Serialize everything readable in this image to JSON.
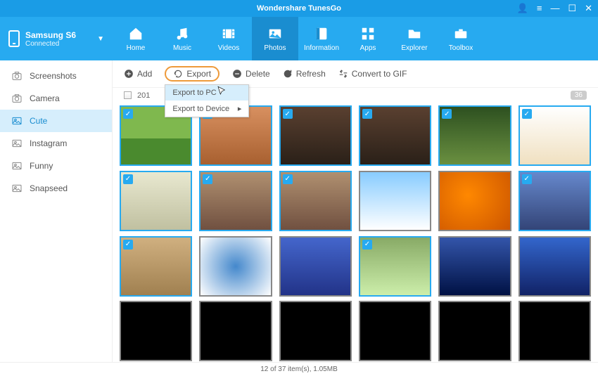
{
  "app": {
    "title": "Wondershare TunesGo"
  },
  "device": {
    "name": "Samsung S6",
    "status": "Connected"
  },
  "nav": [
    {
      "id": "home",
      "label": "Home"
    },
    {
      "id": "music",
      "label": "Music"
    },
    {
      "id": "videos",
      "label": "Videos"
    },
    {
      "id": "photos",
      "label": "Photos",
      "active": true
    },
    {
      "id": "information",
      "label": "Information"
    },
    {
      "id": "apps",
      "label": "Apps"
    },
    {
      "id": "explorer",
      "label": "Explorer"
    },
    {
      "id": "toolbox",
      "label": "Toolbox"
    }
  ],
  "sidebar": [
    {
      "label": "Screenshots",
      "icon": "camera"
    },
    {
      "label": "Camera",
      "icon": "camera"
    },
    {
      "label": "Cute",
      "icon": "picture",
      "active": true
    },
    {
      "label": "Instagram",
      "icon": "picture"
    },
    {
      "label": "Funny",
      "icon": "picture"
    },
    {
      "label": "Snapseed",
      "icon": "picture"
    }
  ],
  "toolbar": {
    "add": "Add",
    "export": "Export",
    "delete": "Delete",
    "refresh": "Refresh",
    "gif": "Convert to GIF"
  },
  "export_menu": {
    "pc": "Export to PC",
    "device": "Export to Device"
  },
  "group": {
    "date": "201",
    "count": "36"
  },
  "thumbs": [
    {
      "cls": "sc-grass",
      "sel": true
    },
    {
      "cls": "sc-basket",
      "sel": true
    },
    {
      "cls": "sc-bridge",
      "sel": true
    },
    {
      "cls": "sc-bridge",
      "sel": true
    },
    {
      "cls": "sc-garden",
      "sel": true
    },
    {
      "cls": "sc-kitten",
      "sel": true
    },
    {
      "cls": "sc-chair",
      "sel": true
    },
    {
      "cls": "sc-blur",
      "sel": true
    },
    {
      "cls": "sc-blur",
      "sel": true
    },
    {
      "cls": "sc-sky",
      "sel": false
    },
    {
      "cls": "sc-orange",
      "sel": false
    },
    {
      "cls": "sc-water",
      "sel": true
    },
    {
      "cls": "sc-cats",
      "sel": true
    },
    {
      "cls": "sc-globe",
      "sel": false
    },
    {
      "cls": "sc-winxp",
      "sel": false
    },
    {
      "cls": "sc-butterfly",
      "sel": true
    },
    {
      "cls": "sc-bluedark",
      "sel": false
    },
    {
      "cls": "sc-xp",
      "sel": false
    },
    {
      "cls": "sc-black",
      "sel": false
    },
    {
      "cls": "sc-black",
      "sel": false
    },
    {
      "cls": "sc-black",
      "sel": false
    },
    {
      "cls": "sc-black",
      "sel": false
    },
    {
      "cls": "sc-black",
      "sel": false
    },
    {
      "cls": "sc-black",
      "sel": false
    }
  ],
  "status": "12 of 37 item(s), 1.05MB"
}
